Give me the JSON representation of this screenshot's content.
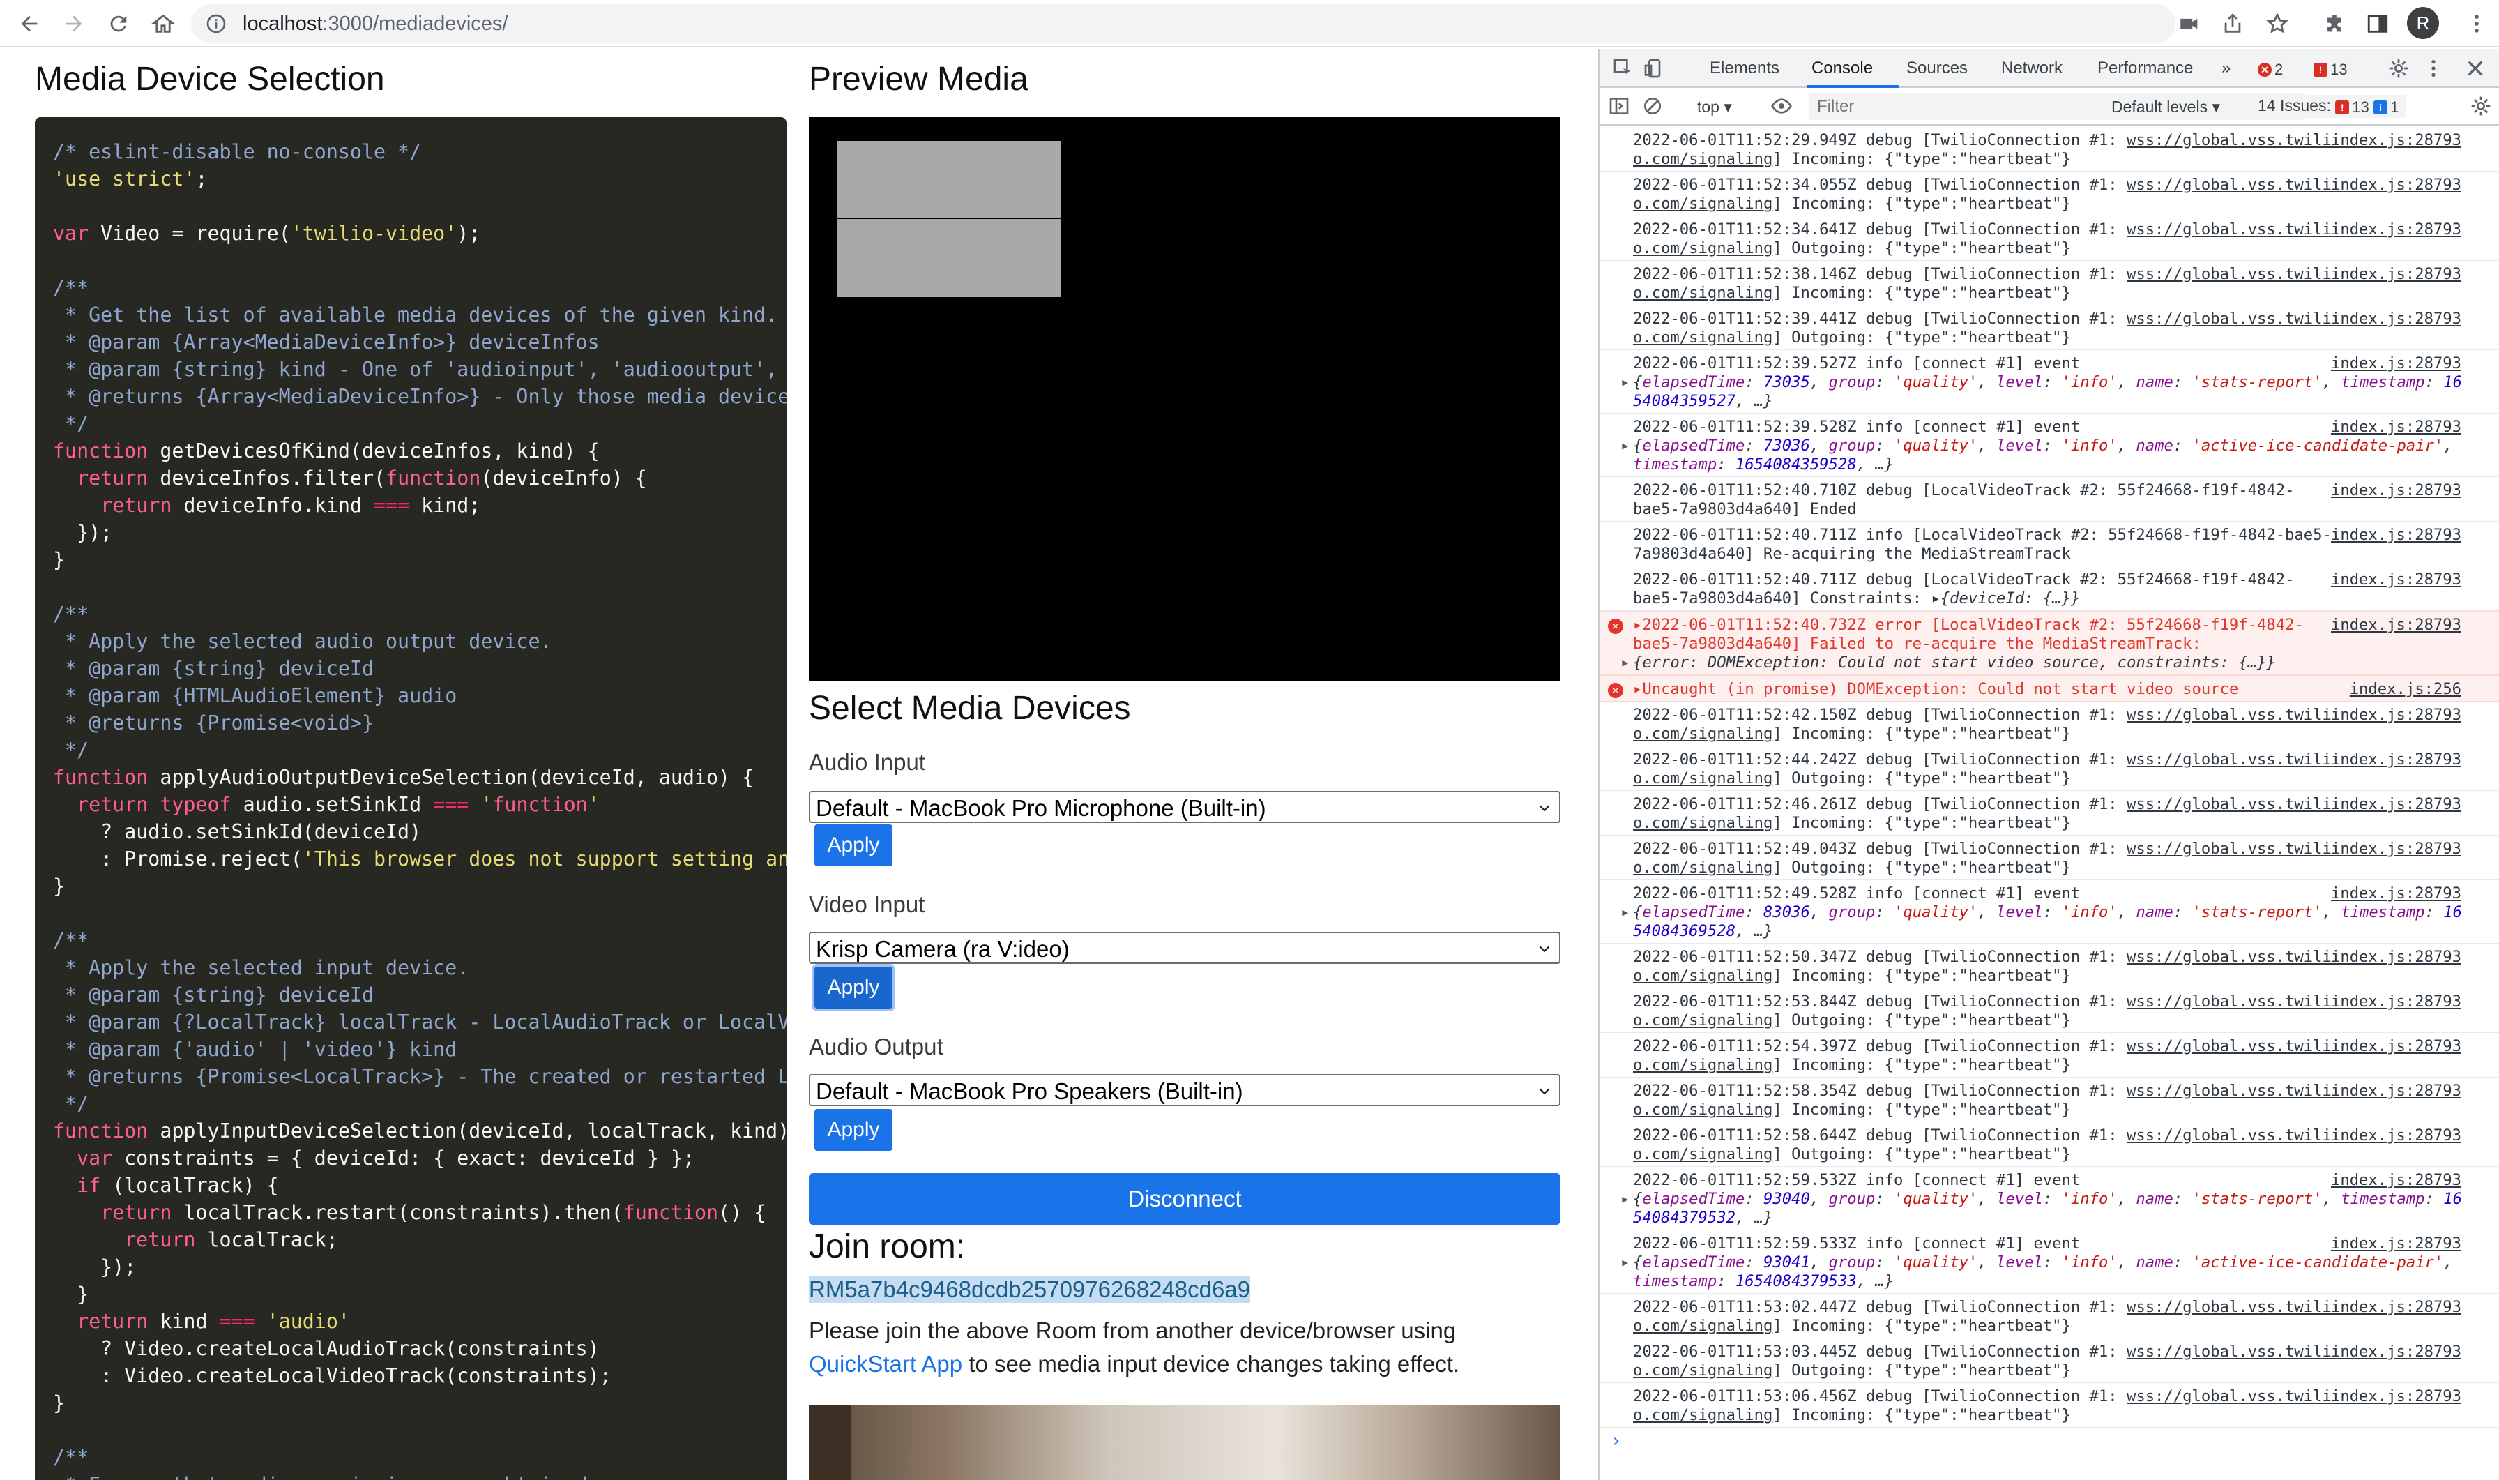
{
  "browser": {
    "url_host": "localhost",
    "url_path": ":3000/mediadevices/",
    "avatar_letter": "R"
  },
  "page": {
    "left_title": "Media Device Selection",
    "preview_title": "Preview Media",
    "select_title": "Select Media Devices",
    "audio_input_label": "Audio Input",
    "audio_input_value": "Default - MacBook Pro Microphone (Built-in)",
    "video_input_label": "Video Input",
    "video_input_value": "Krisp Camera (ra V:ideo)",
    "audio_output_label": "Audio Output",
    "audio_output_value": "Default - MacBook Pro Speakers (Built-in)",
    "apply_label": "Apply",
    "disconnect_label": "Disconnect",
    "join_room_label": "Join room:",
    "room_id": "RM5a7b4c9468dcdb2570976268248cd6a9",
    "join_text_before": "Please join the above Room from another device/browser using ",
    "join_link": "QuickStart App",
    "join_text_after": " to see media input device changes taking effect."
  },
  "code_lines": [
    "/* eslint-disable no-console */",
    "'use strict';",
    "",
    "var Video = require('twilio-video');",
    "",
    "/**",
    " * Get the list of available media devices of the given kind.",
    " * @param {Array<MediaDeviceInfo>} deviceInfos",
    " * @param {string} kind - One of 'audioinput', 'audiooutput', 'video",
    " * @returns {Array<MediaDeviceInfo>} - Only those media devices of t",
    " */",
    "function getDevicesOfKind(deviceInfos, kind) {",
    "  return deviceInfos.filter(function(deviceInfo) {",
    "    return deviceInfo.kind === kind;",
    "  });",
    "}",
    "",
    "/**",
    " * Apply the selected audio output device.",
    " * @param {string} deviceId",
    " * @param {HTMLAudioElement} audio",
    " * @returns {Promise<void>}",
    " */",
    "function applyAudioOutputDeviceSelection(deviceId, audio) {",
    "  return typeof audio.setSinkId === 'function'",
    "    ? audio.setSinkId(deviceId)",
    "    : Promise.reject('This browser does not support setting an audio",
    "}",
    "",
    "/**",
    " * Apply the selected input device.",
    " * @param {string} deviceId",
    " * @param {?LocalTrack} localTrack - LocalAudioTrack or LocalVideoTr",
    " * @param {'audio' | 'video'} kind",
    " * @returns {Promise<LocalTrack>} - The created or restarted LocalTr",
    " */",
    "function applyInputDeviceSelection(deviceId, localTrack, kind) {",
    "  var constraints = { deviceId: { exact: deviceId } };",
    "  if (localTrack) {",
    "    return localTrack.restart(constraints).then(function() {",
    "      return localTrack;",
    "    });",
    "  }",
    "  return kind === 'audio'",
    "    ? Video.createLocalAudioTrack(constraints)",
    "    : Video.createLocalVideoTrack(constraints);",
    "}",
    "",
    "/**",
    " * Ensure that media permissions are obtained."
  ],
  "devtools": {
    "tabs": [
      "Elements",
      "Console",
      "Sources",
      "Network",
      "Performance"
    ],
    "active_tab": "Console",
    "more_tabs": "»",
    "error_count": "2",
    "warning_count": "13",
    "context": "top ▾",
    "filter_placeholder": "Filter",
    "levels": "Default levels ▾",
    "issues_label": "14 Issues:",
    "issues_warn": "13",
    "issues_info": "1",
    "prompt": "›"
  },
  "console_rows": [
    {
      "l1": "2022-06-01T11:52:29.949Z debug [TwilioConnection #1: ",
      "u": "wss://global.vss.twili",
      "l2": "o.com/signaling",
      "l2r": "] Incoming: {\"type\":\"heartbeat\"}",
      "src": "index.js:28793"
    },
    {
      "l1": "2022-06-01T11:52:34.055Z debug [TwilioConnection #1: ",
      "u": "wss://global.vss.twili",
      "l2": "o.com/signaling",
      "l2r": "] Incoming: {\"type\":\"heartbeat\"}",
      "src": "index.js:28793"
    },
    {
      "l1": "2022-06-01T11:52:34.641Z debug [TwilioConnection #1: ",
      "u": "wss://global.vss.twili",
      "l2": "o.com/signaling",
      "l2r": "] Outgoing: {\"type\":\"heartbeat\"}",
      "src": "index.js:28793"
    },
    {
      "l1": "2022-06-01T11:52:38.146Z debug [TwilioConnection #1: ",
      "u": "wss://global.vss.twili",
      "l2": "o.com/signaling",
      "l2r": "] Incoming: {\"type\":\"heartbeat\"}",
      "src": "index.js:28793"
    },
    {
      "l1": "2022-06-01T11:52:39.441Z debug [TwilioConnection #1: ",
      "u": "wss://global.vss.twili",
      "l2": "o.com/signaling",
      "l2r": "] Outgoing: {\"type\":\"heartbeat\"}",
      "src": "index.js:28793"
    }
  ],
  "console_event1": {
    "l1": "2022-06-01T11:52:39.527Z info [connect #1] event",
    "et": "73035",
    "grp": "'quality'",
    "lvl": "'info'",
    "name": "'stats-report'",
    "ts1": "16",
    "ts2": "54084359527",
    "src": "index.js:28793"
  },
  "console_event2": {
    "l1": "2022-06-01T11:52:39.528Z info [connect #1] event",
    "et": "73036",
    "grp": "'quality'",
    "lvl": "'info'",
    "name": "'active-ice-candidate-pair'",
    "ts": "1654084359528",
    "src": "index.js:28793"
  },
  "console_track": [
    {
      "l1": "2022-06-01T11:52:40.710Z debug [LocalVideoTrack #2: 55f24668-f19f-4842-",
      "l2": "bae5-7a9803d4a640] Ended",
      "src": "index.js:28793"
    },
    {
      "l1": "2022-06-01T11:52:40.711Z info [LocalVideoTrack #2: 55f24668-f19f-4842-bae5-",
      "l2": "7a9803d4a640] Re-acquiring the MediaStreamTrack",
      "src": "index.js:28793"
    },
    {
      "l1": "2022-06-01T11:52:40.711Z debug [LocalVideoTrack #2: 55f24668-f19f-4842-",
      "l2": "bae5-7a9803d4a640] Constraints: ",
      "l2obj": "{deviceId: {…}}",
      "src": "index.js:28793"
    }
  ],
  "console_error1": {
    "l1": "2022-06-01T11:52:40.732Z error [LocalVideoTrack #2: 55f24668-f19f-4842-",
    "l2": "bae5-7a9803d4a640] Failed to re-acquire the MediaStreamTrack:",
    "l3": "{error: DOMException: Could not start video source, constraints: {…}}",
    "src": "index.js:28793"
  },
  "console_error2": {
    "l1": "Uncaught (in promise) DOMException: Could not start video source",
    "src": "index.js:256"
  },
  "console_rows2": [
    {
      "l1": "2022-06-01T11:52:42.150Z debug [TwilioConnection #1: ",
      "u": "wss://global.vss.twili",
      "l2": "o.com/signaling",
      "l2r": "] Incoming: {\"type\":\"heartbeat\"}",
      "src": "index.js:28793"
    },
    {
      "l1": "2022-06-01T11:52:44.242Z debug [TwilioConnection #1: ",
      "u": "wss://global.vss.twili",
      "l2": "o.com/signaling",
      "l2r": "] Outgoing: {\"type\":\"heartbeat\"}",
      "src": "index.js:28793"
    },
    {
      "l1": "2022-06-01T11:52:46.261Z debug [TwilioConnection #1: ",
      "u": "wss://global.vss.twili",
      "l2": "o.com/signaling",
      "l2r": "] Incoming: {\"type\":\"heartbeat\"}",
      "src": "index.js:28793"
    },
    {
      "l1": "2022-06-01T11:52:49.043Z debug [TwilioConnection #1: ",
      "u": "wss://global.vss.twili",
      "l2": "o.com/signaling",
      "l2r": "] Outgoing: {\"type\":\"heartbeat\"}",
      "src": "index.js:28793"
    }
  ],
  "console_event3": {
    "l1": "2022-06-01T11:52:49.528Z info [connect #1] event",
    "et": "83036",
    "grp": "'quality'",
    "lvl": "'info'",
    "name": "'stats-report'",
    "ts1": "16",
    "ts2": "54084369528",
    "src": "index.js:28793"
  },
  "console_rows3": [
    {
      "l1": "2022-06-01T11:52:50.347Z debug [TwilioConnection #1: ",
      "u": "wss://global.vss.twili",
      "l2": "o.com/signaling",
      "l2r": "] Incoming: {\"type\":\"heartbeat\"}",
      "src": "index.js:28793"
    },
    {
      "l1": "2022-06-01T11:52:53.844Z debug [TwilioConnection #1: ",
      "u": "wss://global.vss.twili",
      "l2": "o.com/signaling",
      "l2r": "] Outgoing: {\"type\":\"heartbeat\"}",
      "src": "index.js:28793"
    },
    {
      "l1": "2022-06-01T11:52:54.397Z debug [TwilioConnection #1: ",
      "u": "wss://global.vss.twili",
      "l2": "o.com/signaling",
      "l2r": "] Incoming: {\"type\":\"heartbeat\"}",
      "src": "index.js:28793"
    },
    {
      "l1": "2022-06-01T11:52:58.354Z debug [TwilioConnection #1: ",
      "u": "wss://global.vss.twili",
      "l2": "o.com/signaling",
      "l2r": "] Incoming: {\"type\":\"heartbeat\"}",
      "src": "index.js:28793"
    },
    {
      "l1": "2022-06-01T11:52:58.644Z debug [TwilioConnection #1: ",
      "u": "wss://global.vss.twili",
      "l2": "o.com/signaling",
      "l2r": "] Outgoing: {\"type\":\"heartbeat\"}",
      "src": "index.js:28793"
    }
  ],
  "console_event4": {
    "l1": "2022-06-01T11:52:59.532Z info [connect #1] event",
    "et": "93040",
    "grp": "'quality'",
    "lvl": "'info'",
    "name": "'stats-report'",
    "ts1": "16",
    "ts2": "54084379532",
    "src": "index.js:28793"
  },
  "console_event5": {
    "l1": "2022-06-01T11:52:59.533Z info [connect #1] event",
    "et": "93041",
    "grp": "'quality'",
    "lvl": "'info'",
    "name": "'active-ice-candidate-pair'",
    "ts": "1654084379533",
    "src": "index.js:28793"
  },
  "console_rows4": [
    {
      "l1": "2022-06-01T11:53:02.447Z debug [TwilioConnection #1: ",
      "u": "wss://global.vss.twili",
      "l2": "o.com/signaling",
      "l2r": "] Incoming: {\"type\":\"heartbeat\"}",
      "src": "index.js:28793"
    },
    {
      "l1": "2022-06-01T11:53:03.445Z debug [TwilioConnection #1: ",
      "u": "wss://global.vss.twili",
      "l2": "o.com/signaling",
      "l2r": "] Outgoing: {\"type\":\"heartbeat\"}",
      "src": "index.js:28793"
    },
    {
      "l1": "2022-06-01T11:53:06.456Z debug [TwilioConnection #1: ",
      "u": "wss://global.vss.twili",
      "l2": "o.com/signaling",
      "l2r": "] Incoming: {\"type\":\"heartbeat\"}",
      "src": "index.js:28793"
    }
  ]
}
